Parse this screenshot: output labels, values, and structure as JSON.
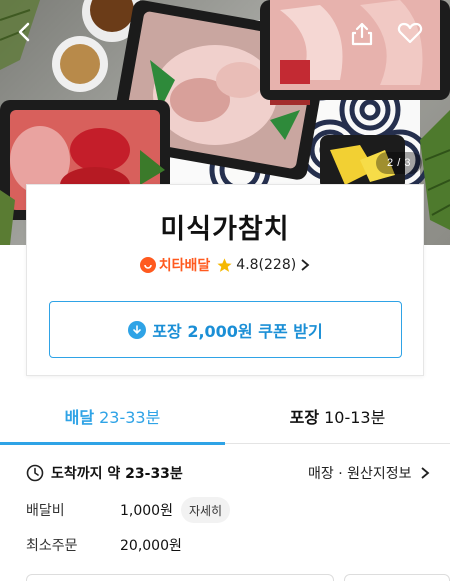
{
  "hero": {
    "image_counter": "2 / 3",
    "icons": {
      "back": "back-arrow-icon",
      "share": "share-icon",
      "like": "heart-icon"
    }
  },
  "store": {
    "name": "미식가참치",
    "delivery_brand": "치타배달",
    "rating": "4.8(228)",
    "coupon_label": "포장 2,000원 쿠폰 받기"
  },
  "tabs": [
    {
      "title": "배달",
      "time": "23-33분",
      "active": true
    },
    {
      "title": "포장",
      "time": "10-13분",
      "active": false
    }
  ],
  "delivery": {
    "eta": "도착까지 약 23-33분",
    "origin_link": "매장 · 원산지정보",
    "fee_label": "배달비",
    "fee_value": "1,000원",
    "detail_button": "자세히",
    "min_order_label": "최소주문",
    "min_order_value": "20,000원"
  },
  "colors": {
    "accent": "#2fa3e6",
    "cheetah": "#ff5a1f",
    "star": "#f5b800"
  }
}
